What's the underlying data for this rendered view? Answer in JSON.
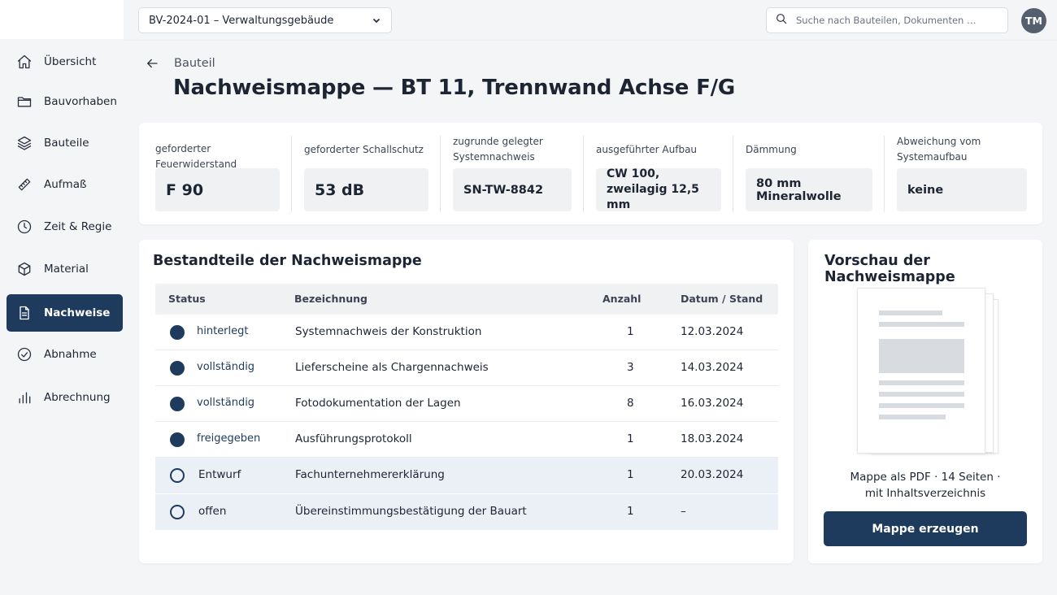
{
  "sidebar": {
    "items": [
      {
        "label": "Übersicht",
        "icon": "home-icon"
      },
      {
        "label": "Bauvorhaben",
        "icon": "folder-icon"
      },
      {
        "label": "Bauteile",
        "icon": "layers-icon"
      },
      {
        "label": "Aufmaß",
        "icon": "ruler-icon"
      },
      {
        "label": "Zeit & Regie",
        "icon": "clock-icon"
      },
      {
        "label": "Material",
        "icon": "box-icon"
      },
      {
        "label": "Nachweise",
        "icon": "document-icon",
        "active": true
      },
      {
        "label": "Abnahme",
        "icon": "check-circle-icon"
      },
      {
        "label": "Abrechnung",
        "icon": "bar-chart-icon"
      }
    ]
  },
  "topbar": {
    "project": "BV-2024-01 – Verwaltungsgebäude",
    "search_placeholder": "Suche nach Bauteilen, Dokumenten …",
    "avatar_initials": "TM"
  },
  "header": {
    "breadcrumb": "Bauteil",
    "title": "Nachweismappe — BT 11, Trennwand Achse F/G"
  },
  "properties": [
    {
      "label": "geforderter Feuerwiderstand",
      "value": "F 90"
    },
    {
      "label": "geforderter Schallschutz",
      "value": "53 dB"
    },
    {
      "label": "zugrunde gelegter Systemnachweis",
      "value": "SN-TW-8842"
    },
    {
      "label": "ausgeführter Aufbau",
      "value": "CW 100, zweilagig 12,5 mm"
    },
    {
      "label": "Dämmung",
      "value": "80 mm Mineralwolle"
    },
    {
      "label": "Abweichung vom Systemaufbau",
      "value": "keine"
    }
  ],
  "components": {
    "title": "Bestandteile der Nachweismappe",
    "columns": {
      "status": "Status",
      "name": "Bezeichnung",
      "count": "Anzahl",
      "date": "Datum / Stand"
    },
    "rows": [
      {
        "status": "hinterlegt",
        "name": "Systemnachweis der Konstruktion",
        "count": "1",
        "date": "12.03.2024",
        "done": true
      },
      {
        "status": "vollständig",
        "name": "Lieferscheine als Chargennachweis",
        "count": "3",
        "date": "14.03.2024",
        "done": true
      },
      {
        "status": "vollständig",
        "name": "Fotodokumentation der Lagen",
        "count": "8",
        "date": "16.03.2024",
        "done": true
      },
      {
        "status": "freigegeben",
        "name": "Ausführungsprotokoll",
        "count": "1",
        "date": "18.03.2024",
        "done": true
      },
      {
        "status": "Entwurf",
        "name": "Fachunternehmererklärung",
        "count": "1",
        "date": "20.03.2024",
        "done": false
      },
      {
        "status": "offen",
        "name": "Übereinstimmungsbestätigung der Bauart",
        "count": "1",
        "date": "–",
        "done": false
      }
    ]
  },
  "preview": {
    "title": "Vorschau der Nachweismappe",
    "info_line1": "Mappe als PDF · 14 Seiten ·",
    "info_line2": "mit Inhaltsverzeichnis",
    "button": "Mappe erzeugen"
  },
  "colors": {
    "accent": "#1e3a5c",
    "background": "#f4f5f7",
    "highlight_row": "#ebf0f7"
  }
}
